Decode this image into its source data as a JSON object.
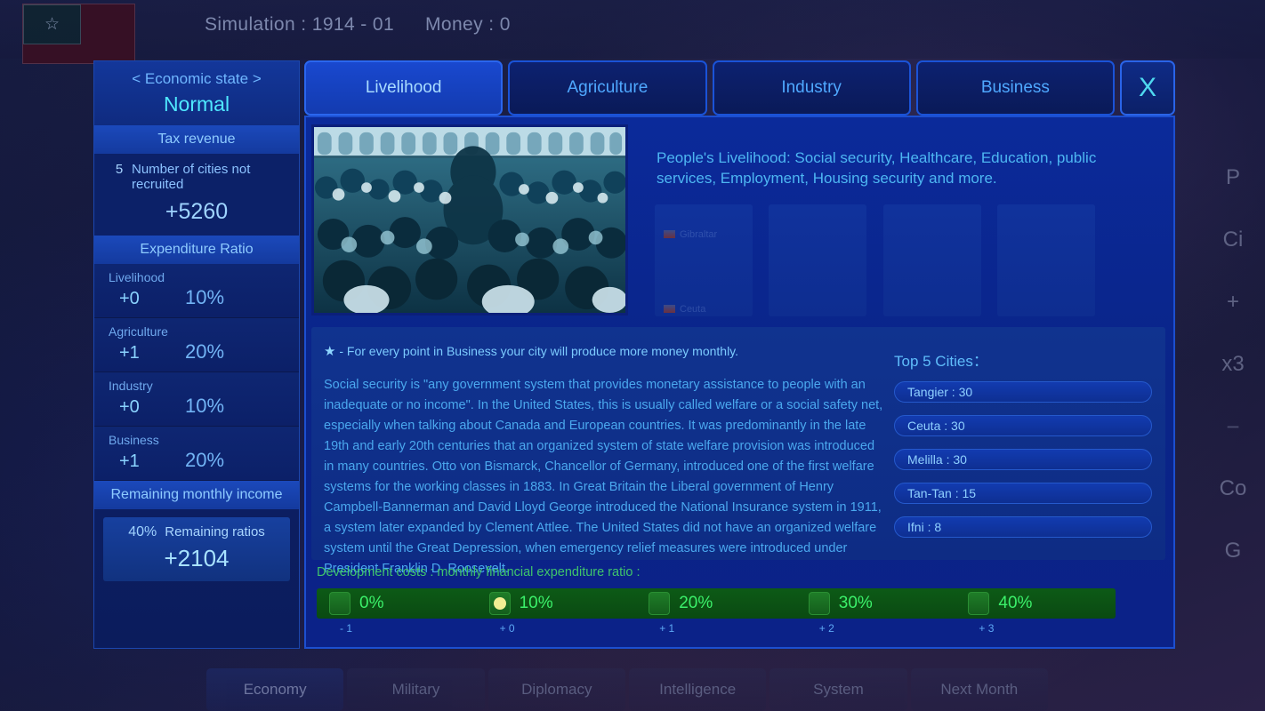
{
  "topbar": {
    "simulation": "Simulation : 1914 - 01",
    "money": "Money : 0",
    "flag_icon": "morocco-flag-star"
  },
  "economy_panel": {
    "header_title": "< Economic state >",
    "header_value": "Normal",
    "tax_section_label": "Tax revenue",
    "cities_not_recruited_count": "5",
    "cities_not_recruited_label": "Number of cities not recruited",
    "tax_amount": "+5260",
    "expenditure_label": "Expenditure Ratio",
    "rows": [
      {
        "category": "Livelihood",
        "delta": "+0",
        "percent": "10%"
      },
      {
        "category": "Agriculture",
        "delta": "+1",
        "percent": "20%"
      },
      {
        "category": "Industry",
        "delta": "+0",
        "percent": "10%"
      },
      {
        "category": "Business",
        "delta": "+1",
        "percent": "20%"
      }
    ],
    "remaining_income_label": "Remaining monthly income",
    "remaining_ratio": "40%",
    "remaining_ratio_label": "Remaining ratios",
    "remaining_amount": "+2104"
  },
  "tabs": [
    {
      "label": "Livelihood",
      "active": true
    },
    {
      "label": "Agriculture",
      "active": false
    },
    {
      "label": "Industry",
      "active": false
    },
    {
      "label": "Business",
      "active": false
    }
  ],
  "close_button": "X",
  "content": {
    "description": "People's Livelihood: Social security, Healthcare, Education, public services, Employment, Housing security and more.",
    "photo_caption": "historical-crowd-photograph",
    "ghost_items": [
      {
        "label": "Gibraltar"
      },
      {
        "label": "Ceuta"
      }
    ],
    "star_note": "- For every point in Business your city will produce more money monthly.",
    "star_icon": "★",
    "article": "Social security is \"any government system that provides monetary assistance to people with an inadequate or no income\". In the United States, this is usually called welfare or a social safety net, especially when talking about Canada and European countries. It was predominantly in the late 19th and early 20th centuries that an organized system of state welfare provision was introduced in many countries. Otto von Bismarck, Chancellor of Germany, introduced one of the first welfare systems for the working classes in 1883. In Great Britain the Liberal government of Henry Campbell-Bannerman and David Lloyd George introduced the National Insurance system in 1911, a system later expanded by Clement Attlee. The United States did not have an organized welfare system until the Great Depression, when emergency relief measures were introduced under President Franklin D. Roosevelt.",
    "top_cities_title": "Top 5 Cities：",
    "top_cities": [
      {
        "label": "Tangier : 30"
      },
      {
        "label": "Ceuta : 30"
      },
      {
        "label": "Melilla : 30"
      },
      {
        "label": "Tan-Tan : 15"
      },
      {
        "label": "Ifni : 8"
      }
    ]
  },
  "development": {
    "title": "Development costs : monthly financial expenditure ratio :",
    "options": [
      {
        "percent": "0%",
        "tick": "- 1",
        "selected": false
      },
      {
        "percent": "10%",
        "tick": "+ 0",
        "selected": true
      },
      {
        "percent": "20%",
        "tick": "+ 1",
        "selected": false
      },
      {
        "percent": "30%",
        "tick": "+ 2",
        "selected": false
      },
      {
        "percent": "40%",
        "tick": "+ 3",
        "selected": false
      }
    ]
  },
  "right_rail": [
    {
      "label": "P"
    },
    {
      "label": "Ci"
    },
    {
      "label": "+"
    },
    {
      "label": "x3"
    },
    {
      "label": "−"
    },
    {
      "label": "Co"
    },
    {
      "label": "G"
    }
  ],
  "bottom_nav": [
    {
      "label": "Economy",
      "selected": true
    },
    {
      "label": "Military",
      "selected": false
    },
    {
      "label": "Diplomacy",
      "selected": false
    },
    {
      "label": "Intelligence",
      "selected": false
    },
    {
      "label": "System",
      "selected": false
    },
    {
      "label": "Next Month",
      "selected": false
    }
  ],
  "colors": {
    "accent_cyan": "#4fe8ff",
    "panel_blue": "#0d2269",
    "tab_active": "#1948cf",
    "green_bar": "#0d5a16",
    "green_text": "#3bf06a",
    "selected_dot": "#f2ef93"
  }
}
